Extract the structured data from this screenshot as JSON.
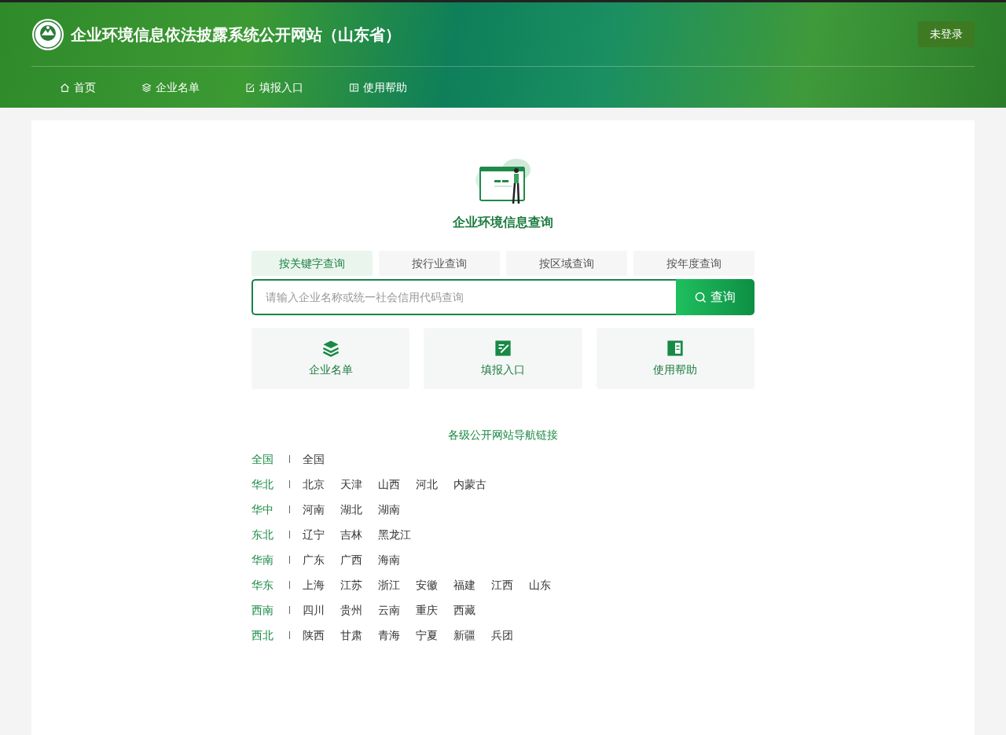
{
  "header": {
    "title": "企业环境信息依法披露系统公开网站（山东省）",
    "login_button": "未登录",
    "nav": [
      {
        "kind": "home",
        "label": "首页"
      },
      {
        "kind": "layers",
        "label": "企业名单"
      },
      {
        "kind": "edit",
        "label": "填报入口"
      },
      {
        "kind": "book",
        "label": "使用帮助"
      }
    ]
  },
  "query": {
    "title": "企业环境信息查询",
    "tabs": [
      {
        "label": "按关键字查询",
        "selected": true
      },
      {
        "label": "按行业查询",
        "selected": false
      },
      {
        "label": "按区域查询",
        "selected": false
      },
      {
        "label": "按年度查询",
        "selected": false
      }
    ],
    "search": {
      "placeholder": "请输入企业名称或统一社会信用代码查询",
      "button": "查询"
    },
    "shortcuts": [
      {
        "kind": "layers",
        "label": "企业名单"
      },
      {
        "kind": "edit",
        "label": "填报入口"
      },
      {
        "kind": "book",
        "label": "使用帮助"
      }
    ]
  },
  "links": {
    "title": "各级公开网站导航链接",
    "regions": [
      {
        "name": "全国",
        "sites": [
          "全国"
        ]
      },
      {
        "name": "华北",
        "sites": [
          "北京",
          "天津",
          "山西",
          "河北",
          "内蒙古"
        ]
      },
      {
        "name": "华中",
        "sites": [
          "河南",
          "湖北",
          "湖南"
        ]
      },
      {
        "name": "东北",
        "sites": [
          "辽宁",
          "吉林",
          "黑龙江"
        ]
      },
      {
        "name": "华南",
        "sites": [
          "广东",
          "广西",
          "海南"
        ]
      },
      {
        "name": "华东",
        "sites": [
          "上海",
          "江苏",
          "浙江",
          "安徽",
          "福建",
          "江西",
          "山东"
        ]
      },
      {
        "name": "西南",
        "sites": [
          "四川",
          "贵州",
          "云南",
          "重庆",
          "西藏"
        ]
      },
      {
        "name": "西北",
        "sites": [
          "陕西",
          "甘肃",
          "青海",
          "宁夏",
          "新疆",
          "兵团"
        ]
      }
    ]
  }
}
